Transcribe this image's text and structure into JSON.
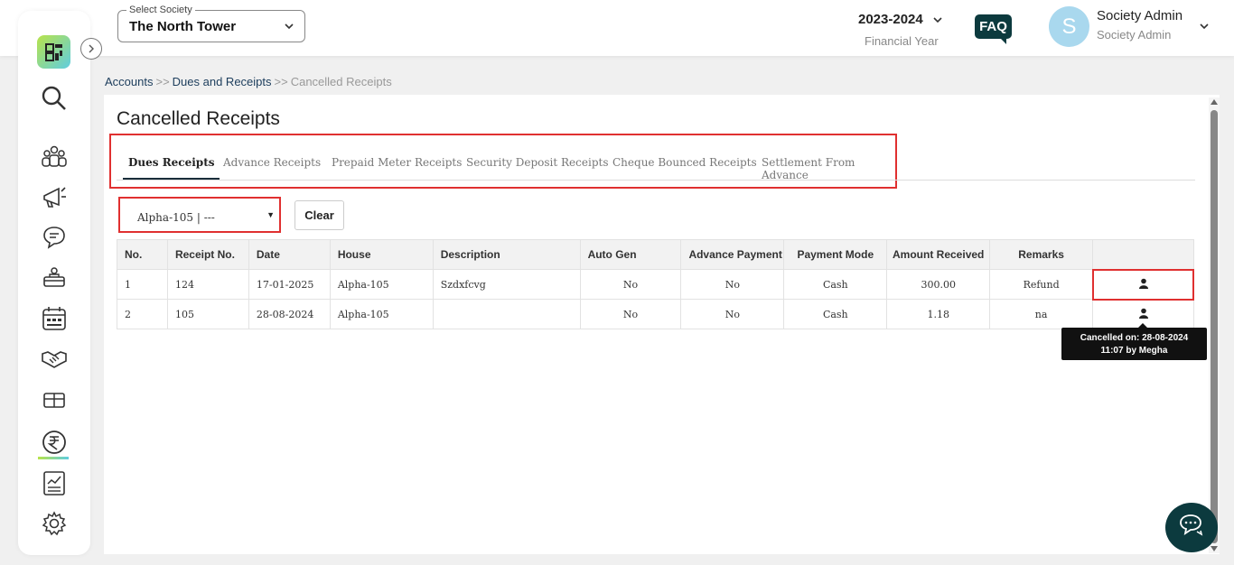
{
  "header": {
    "society_label": "Select Society",
    "society_value": "The North Tower",
    "financial_year": "2023-2024",
    "financial_year_label": "Financial Year",
    "faq": "FAQ",
    "avatar_letter": "S",
    "user_name": "Society Admin",
    "user_role": "Society Admin"
  },
  "sidebar": {
    "icons": [
      "search-icon",
      "members-icon",
      "announcement-icon",
      "chat-icon",
      "staff-icon",
      "calendar-icon",
      "handshake-icon",
      "amenity-icon",
      "rupee-icon",
      "report-icon",
      "settings-icon"
    ],
    "active": "rupee-icon",
    "accent_gradient": [
      "#b8e34a",
      "#5fcde0"
    ]
  },
  "breadcrumb": {
    "items": [
      "Accounts",
      "Dues and Receipts",
      "Cancelled Receipts"
    ],
    "separator": ">>"
  },
  "page": {
    "title": "Cancelled Receipts",
    "tabs": [
      "Dues Receipts",
      "Advance Receipts",
      "Prepaid Meter Receipts",
      "Security Deposit Receipts",
      "Cheque Bounced Receipts",
      "Settlement From Advance"
    ],
    "active_tab": "Dues Receipts",
    "filter_value": "Alpha-105 | ---",
    "clear_label": "Clear"
  },
  "table": {
    "headers": [
      "No.",
      "Receipt No.",
      "Date",
      "House",
      "Description",
      "Auto Gen",
      "Advance Payment",
      "Payment Mode",
      "Amount Received",
      "Remarks",
      ""
    ],
    "rows": [
      {
        "no": "1",
        "receipt": "124",
        "date": "17-01-2025",
        "house": "Alpha-105",
        "description": "Szdxfcvg",
        "auto_gen": "No",
        "advance": "No",
        "mode": "Cash",
        "amount": "300.00",
        "remarks": "Refund"
      },
      {
        "no": "2",
        "receipt": "105",
        "date": "28-08-2024",
        "house": "Alpha-105",
        "description": "",
        "auto_gen": "No",
        "advance": "No",
        "mode": "Cash",
        "amount": "1.18",
        "remarks": "na"
      }
    ]
  },
  "tooltip": {
    "line1": "Cancelled on: 28-08-2024",
    "line2": "11:07 by Megha"
  },
  "colors": {
    "brand_dark": "#0c3a3e",
    "highlight_red": "#e03030"
  }
}
